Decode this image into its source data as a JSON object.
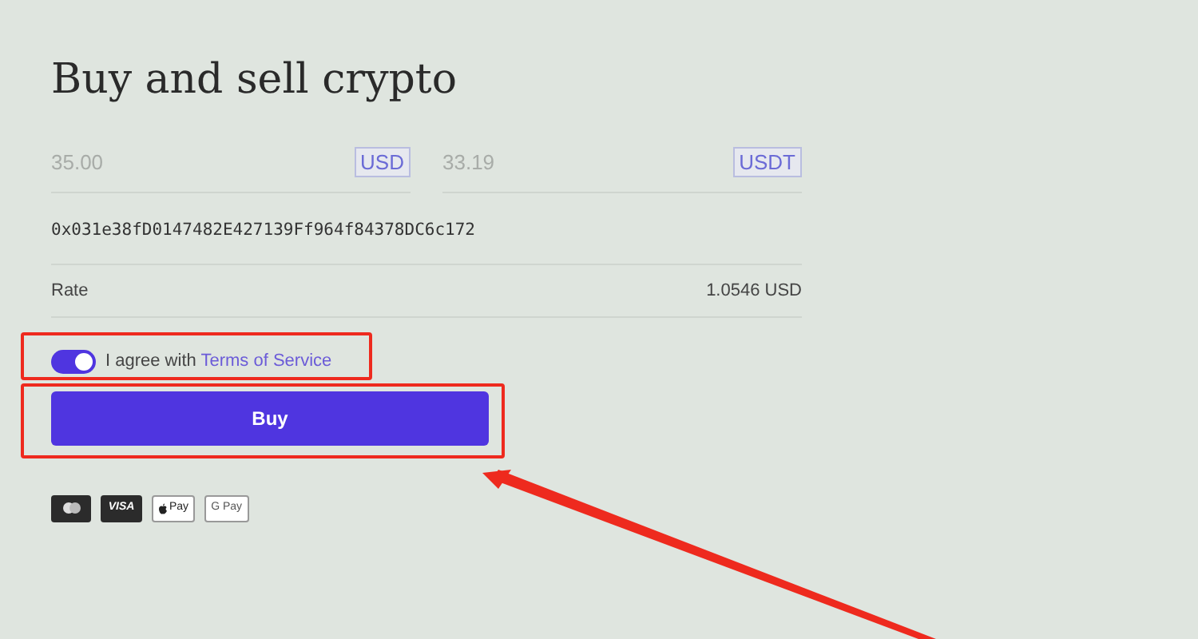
{
  "title": "Buy and sell crypto",
  "amounts": [
    {
      "placeholder": "35.00",
      "currency": "USD"
    },
    {
      "placeholder": "33.19",
      "currency": "USDT"
    }
  ],
  "wallet_address": "0x031e38fD0147482E427139Ff964f84378DC6c172",
  "rate": {
    "label": "Rate",
    "value": "1.0546 USD"
  },
  "agreement": {
    "on": true,
    "text": "I agree with",
    "link": "Terms of Service"
  },
  "buy_button": "Buy",
  "payment_methods": [
    {
      "kind": "mastercard"
    },
    {
      "kind": "visa",
      "label": "VISA"
    },
    {
      "kind": "applepay",
      "label": "Pay"
    },
    {
      "kind": "googlepay",
      "label": "G Pay"
    }
  ]
}
